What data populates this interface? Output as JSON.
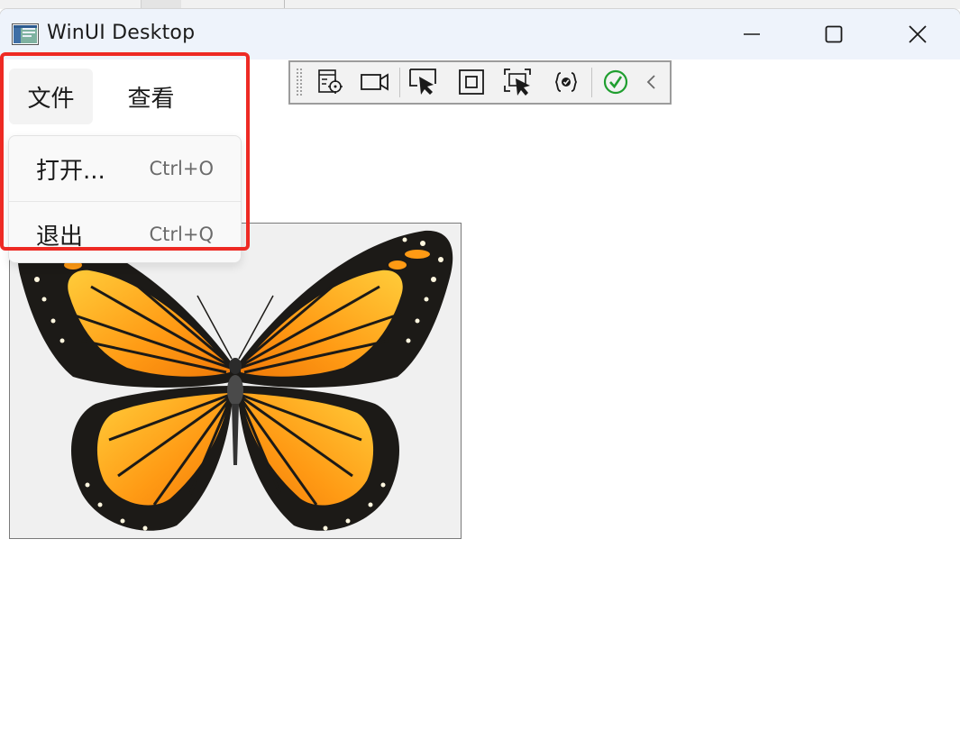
{
  "window": {
    "title": "WinUI Desktop",
    "app_icon": "app-window-icon",
    "caption_buttons": [
      "minimize-icon",
      "maximize-icon",
      "close-icon"
    ]
  },
  "menubar": {
    "items": [
      {
        "label": "文件",
        "active": true
      },
      {
        "label": "查看",
        "active": false
      }
    ]
  },
  "file_menu": {
    "items": [
      {
        "label": "打开...",
        "shortcut": "Ctrl+O"
      },
      {
        "label": "退出",
        "shortcut": "Ctrl+Q"
      }
    ]
  },
  "debug_toolbar": {
    "buttons": [
      "live-visual-tree-target-icon",
      "record-video-icon",
      "select-element-icon",
      "display-layout-adorners-icon",
      "track-focus-icon",
      "binding-failures-icon",
      "accessibility-check-icon",
      "collapse-toolbar-icon"
    ],
    "accent": "#1f9e2f"
  },
  "image": {
    "subject": "butterfly-image"
  },
  "annotation": {
    "color": "#ee2a24"
  }
}
